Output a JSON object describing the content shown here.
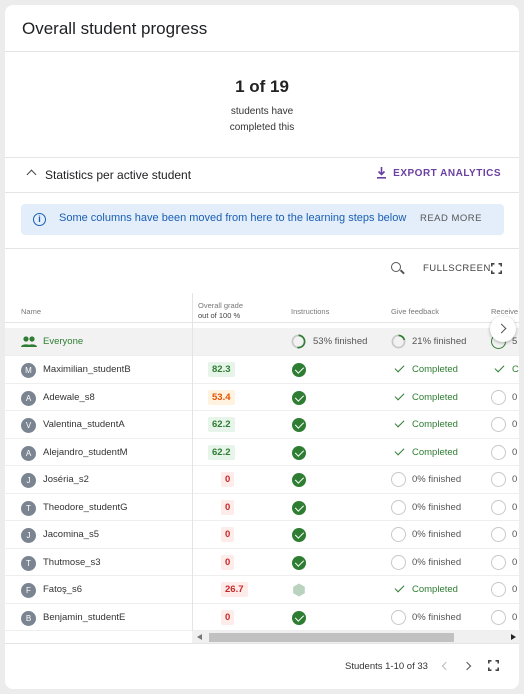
{
  "header": {
    "title": "Overall student progress"
  },
  "summary": {
    "count": "1 of 19",
    "line1": "students have",
    "line2": "completed this"
  },
  "stats": {
    "label": "Statistics per active student",
    "export_label": "EXPORT ANALYTICS"
  },
  "info": {
    "text": "Some columns have been moved from here to the learning steps below",
    "read_more": "READ MORE"
  },
  "toolbar": {
    "fullscreen_label": "FULLSCREEN"
  },
  "columns": {
    "name": "Name",
    "grade": "Overall grade",
    "grade_sub": "out of 100 %",
    "instructions": "Instructions",
    "feedback": "Give feedback",
    "received": "Receive"
  },
  "everyone": {
    "label": "Everyone",
    "instructions": "53% finished",
    "instructions_pct": 53,
    "feedback": "21% finished",
    "feedback_pct": 21,
    "received": "5"
  },
  "students": [
    {
      "initial": "M",
      "name": "Maximilian_studentB",
      "grade": "82.3",
      "grade_color": "green",
      "instr": "done",
      "feedback": "Completed",
      "fb_done": true,
      "received": "Co"
    },
    {
      "initial": "A",
      "name": "Adewale_s8",
      "grade": "53.4",
      "grade_color": "orange",
      "instr": "done",
      "feedback": "Completed",
      "fb_done": true,
      "received": "0"
    },
    {
      "initial": "V",
      "name": "Valentina_studentA",
      "grade": "62.2",
      "grade_color": "green",
      "instr": "done",
      "feedback": "Completed",
      "fb_done": true,
      "received": "0"
    },
    {
      "initial": "A",
      "name": "Alejandro_studentM",
      "grade": "62.2",
      "grade_color": "green",
      "instr": "done",
      "feedback": "Completed",
      "fb_done": true,
      "received": "0"
    },
    {
      "initial": "J",
      "name": "Joséria_s2",
      "grade": "0",
      "grade_color": "red",
      "instr": "done",
      "feedback": "0% finished",
      "fb_done": false,
      "received": "0"
    },
    {
      "initial": "T",
      "name": "Theodore_studentG",
      "grade": "0",
      "grade_color": "red",
      "instr": "done",
      "feedback": "0% finished",
      "fb_done": false,
      "received": "0"
    },
    {
      "initial": "J",
      "name": "Jacomina_s5",
      "grade": "0",
      "grade_color": "red",
      "instr": "done",
      "feedback": "0% finished",
      "fb_done": false,
      "received": "0"
    },
    {
      "initial": "T",
      "name": "Thutmose_s3",
      "grade": "0",
      "grade_color": "red",
      "instr": "done",
      "feedback": "0% finished",
      "fb_done": false,
      "received": "0"
    },
    {
      "initial": "F",
      "name": "Fatoş_s6",
      "grade": "26.7",
      "grade_color": "red",
      "instr": "pending",
      "feedback": "Completed",
      "fb_done": true,
      "received": "0"
    },
    {
      "initial": "B",
      "name": "Benjamin_studentE",
      "grade": "0",
      "grade_color": "red",
      "instr": "done",
      "feedback": "0% finished",
      "fb_done": false,
      "received": "0"
    }
  ],
  "footer": {
    "pagination": "Students 1-10 of 33"
  }
}
